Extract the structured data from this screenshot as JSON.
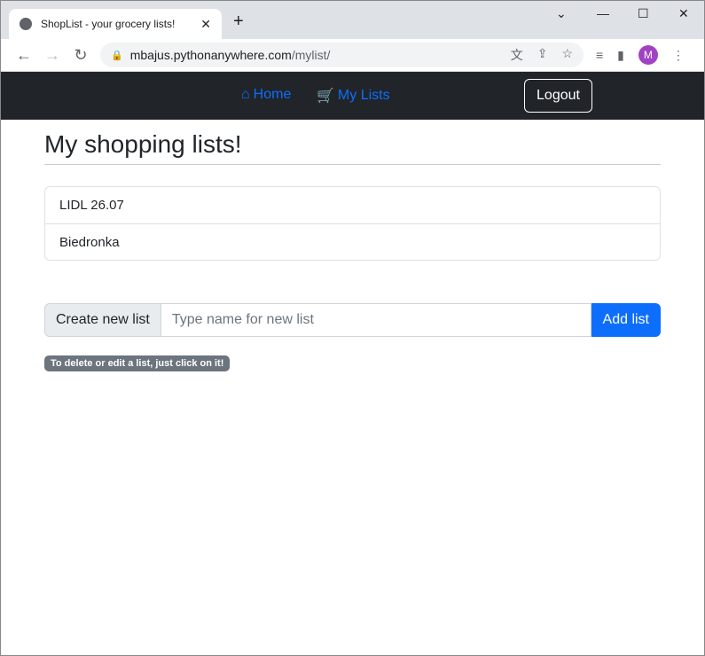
{
  "browser": {
    "tab_title": "ShopList - your grocery lists!",
    "url_host": "mbajus.pythonanywhere.com",
    "url_path": "/mylist/",
    "avatar_letter": "M"
  },
  "navbar": {
    "home": "Home",
    "my_lists": "My Lists",
    "logout": "Logout"
  },
  "page": {
    "title": "My shopping lists!",
    "lists": [
      "LIDL 26.07",
      "Biedronka"
    ],
    "create_label": "Create new list",
    "input_placeholder": "Type name for new list",
    "input_value": "",
    "add_button": "Add list",
    "hint": "To delete or edit a list, just click on it!"
  },
  "colors": {
    "accent": "#0d6efd",
    "navbar": "#212529",
    "badge": "#6c757d"
  }
}
